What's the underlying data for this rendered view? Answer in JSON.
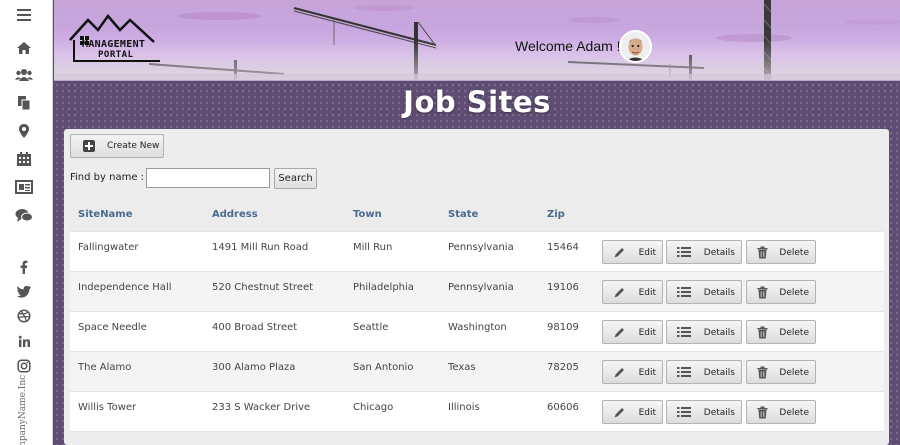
{
  "header": {
    "logo_line1": "MANAGEMENT",
    "logo_line2": "PORTAL",
    "welcome_text": "Welcome Adam !"
  },
  "sidebar": {
    "icons": [
      "menu-icon",
      "home-icon",
      "users-icon",
      "copy-icon",
      "map-marker-icon",
      "calendar-icon",
      "newspaper-icon",
      "comments-icon",
      "facebook-icon",
      "twitter-icon",
      "dribbble-icon",
      "linkedin-icon",
      "instagram-icon"
    ],
    "footer_text": "CompanyName.Inc"
  },
  "page": {
    "title": "Job Sites"
  },
  "toolbar": {
    "create_label": "Create New",
    "find_label": "Find by name :",
    "find_value": "",
    "search_label": "Search"
  },
  "table": {
    "columns": [
      "SiteName",
      "Address",
      "Town",
      "State",
      "Zip"
    ],
    "rows": [
      {
        "site": "Fallingwater",
        "address": "1491 Mill Run Road",
        "town": "Mill Run",
        "state": "Pennsylvania",
        "zip": "15464"
      },
      {
        "site": "Independence Hall",
        "address": "520 Chestnut Street",
        "town": "Philadelphia",
        "state": "Pennsylvania",
        "zip": "19106"
      },
      {
        "site": "Space Needle",
        "address": "400 Broad Street",
        "town": "Seattle",
        "state": "Washington",
        "zip": "98109"
      },
      {
        "site": "The Alamo",
        "address": "300 Alamo Plaza",
        "town": "San Antonio",
        "state": "Texas",
        "zip": "78205"
      },
      {
        "site": "Willis Tower",
        "address": "233 S Wacker Drive",
        "town": "Chicago",
        "state": "Illinois",
        "zip": "60606"
      }
    ],
    "actions": {
      "edit_label": "Edit",
      "details_label": "Details",
      "delete_label": "Delete"
    }
  },
  "colors": {
    "header_sky": "#c7a6df",
    "main_bg": "#5f4d73",
    "column_header_text": "#4a6b8f",
    "panel_bg": "#ededed"
  }
}
